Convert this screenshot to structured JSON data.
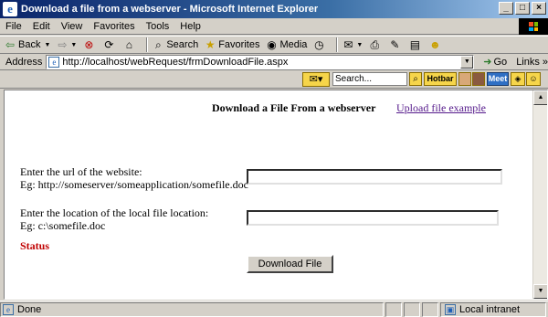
{
  "window": {
    "title": "Download a file from a webserver - Microsoft Internet Explorer",
    "minimize": "_",
    "maximize": "□",
    "close": "×"
  },
  "menu": {
    "items": [
      "File",
      "Edit",
      "View",
      "Favorites",
      "Tools",
      "Help"
    ]
  },
  "toolbar": {
    "back_label": "Back",
    "search_label": "Search",
    "favorites_label": "Favorites",
    "media_label": "Media"
  },
  "address": {
    "label": "Address",
    "url": "http://localhost/webRequest/frmDownloadFile.aspx",
    "go_label": "Go",
    "links_label": "Links"
  },
  "toolbar2": {
    "search_placeholder": "Search...",
    "hotbar_label": "Hotbar",
    "meet_label": "Meet"
  },
  "page": {
    "heading": "Download a File From a webserver",
    "upload_link": "Upload file example",
    "url_label_line1": "Enter the url of the website:",
    "url_label_line2": "Eg: http://someserver/someapplication/somefile.doc",
    "url_value": "",
    "local_label_line1": "Enter the location of the local file location:",
    "local_label_line2": "Eg: c:\\somefile.doc",
    "local_value": "",
    "status_text": "Status",
    "download_button": "Download File"
  },
  "statusbar": {
    "status": "Done",
    "zone": "Local intranet"
  },
  "colors": {
    "status_red": "#c00000",
    "visited_link": "#551a8b",
    "titlebar_blue": "#0a246a"
  }
}
